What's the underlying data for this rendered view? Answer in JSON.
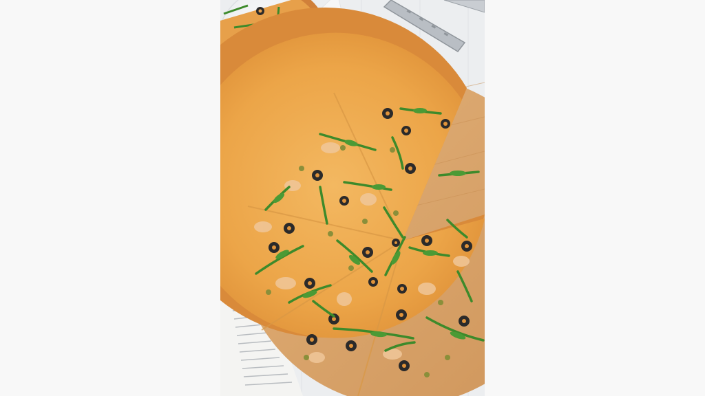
{
  "photo": {
    "subject": "pizza-with-olives-capers-arugula",
    "colors": {
      "page_background": "#f8f8f8",
      "table": "#eceef0",
      "crust": "#d98a3a",
      "cheese": "#eeac4f",
      "board": "#d9a46a",
      "olive": "#2b2a2a",
      "arugula": "#3d8a2b",
      "caper": "#8a8f3a"
    }
  }
}
